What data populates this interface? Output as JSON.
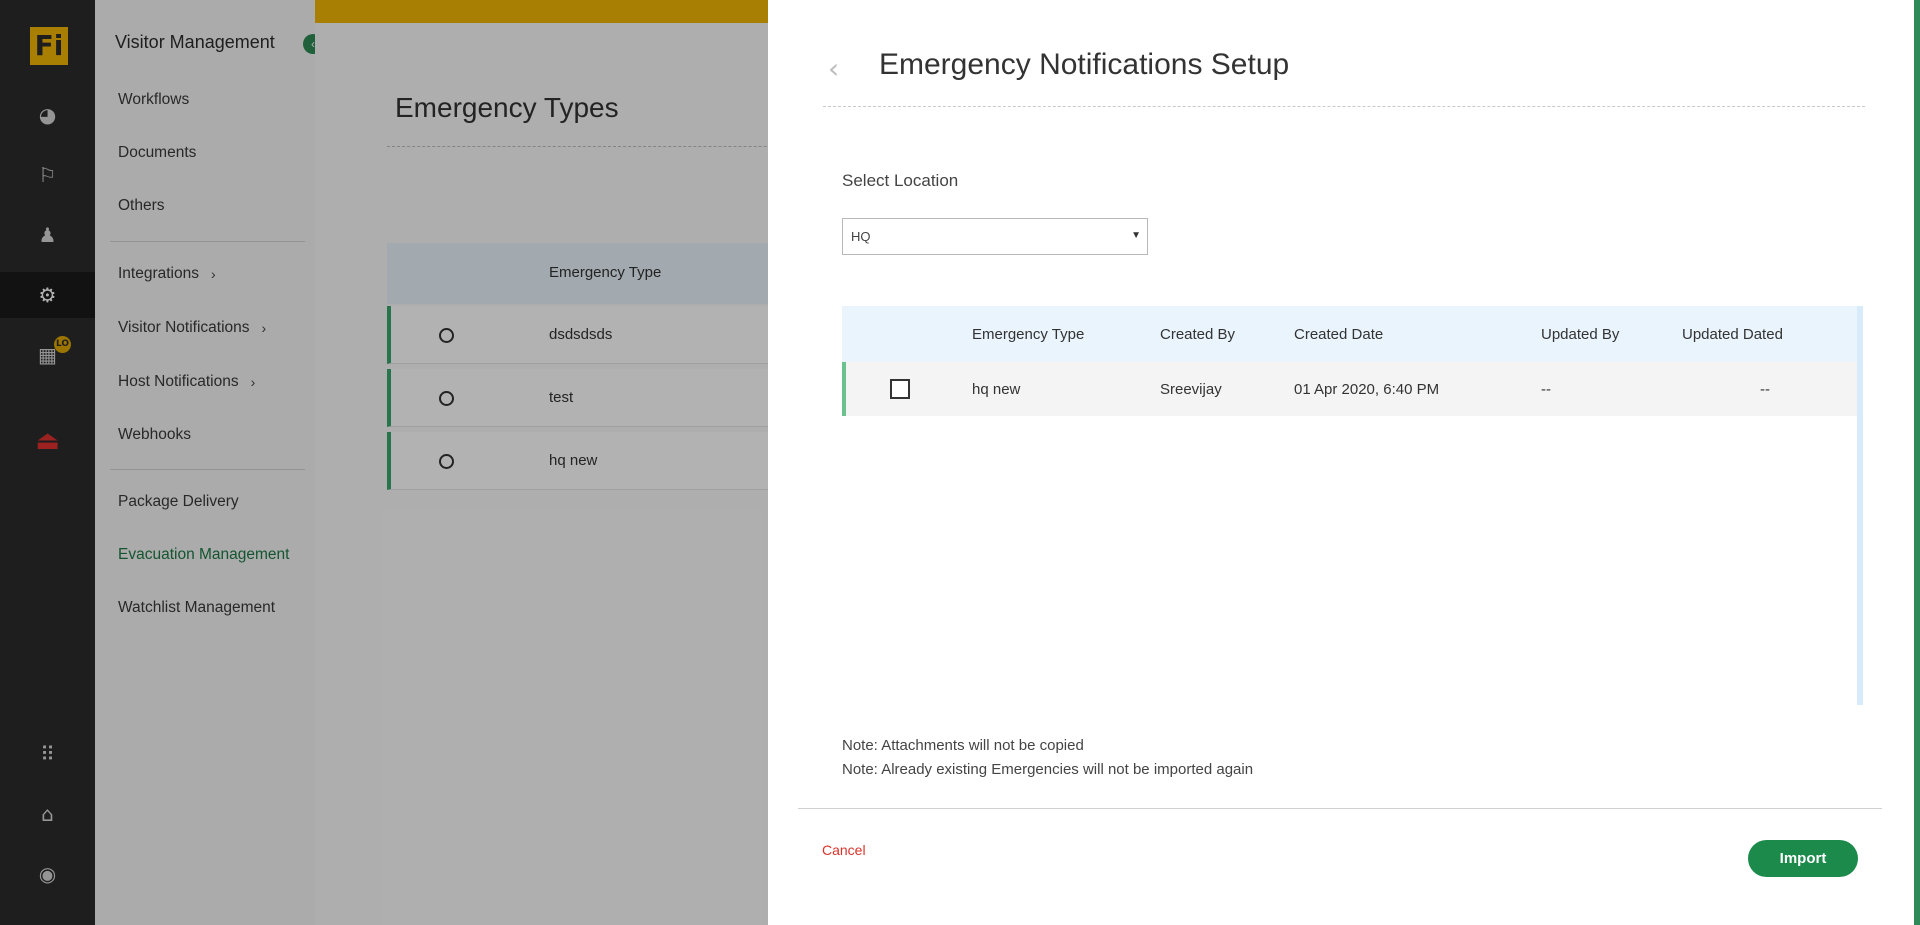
{
  "rail": {
    "logo_text": "Fi",
    "badge": "LO",
    "icons": [
      "dashboard-icon",
      "visitor-walk-icon",
      "add-user-icon",
      "gear-icon",
      "building-icon",
      "siren-icon",
      "apps-grid-icon",
      "bank-icon",
      "account-circle-icon"
    ]
  },
  "subnav": {
    "title": "Visitor Management",
    "group1": [
      "Workflows",
      "Documents",
      "Others"
    ],
    "group2": [
      "Integrations",
      "Visitor Notifications",
      "Host Notifications",
      "Webhooks"
    ],
    "group3": [
      "Package Delivery",
      "Evacuation Management",
      "Watchlist Management"
    ],
    "active": "Evacuation Management"
  },
  "background": {
    "page_title": "Emergency Types",
    "column_header": "Emergency Type",
    "rows": [
      "dsdsdsds",
      "test",
      "hq new"
    ]
  },
  "drawer": {
    "title": "Emergency Notifications Setup",
    "location_label": "Select Location",
    "location_value": "HQ",
    "columns": [
      "Emergency Type",
      "Created By",
      "Created Date",
      "Updated By",
      "Updated Dated"
    ],
    "rows": [
      {
        "emergency_type": "hq new",
        "created_by": "Sreevijay",
        "created_date": "01 Apr 2020, 6:40 PM",
        "updated_by": "--",
        "updated_date": "--"
      }
    ],
    "notes": [
      "Note: Attachments will not be copied",
      "Note: Already existing Emergencies will not be imported again"
    ],
    "cancel_label": "Cancel",
    "import_label": "Import"
  },
  "colors": {
    "brand_yellow": "#f2b705",
    "accent_green": "#1b8a4a",
    "cancel_red": "#d9342b"
  }
}
